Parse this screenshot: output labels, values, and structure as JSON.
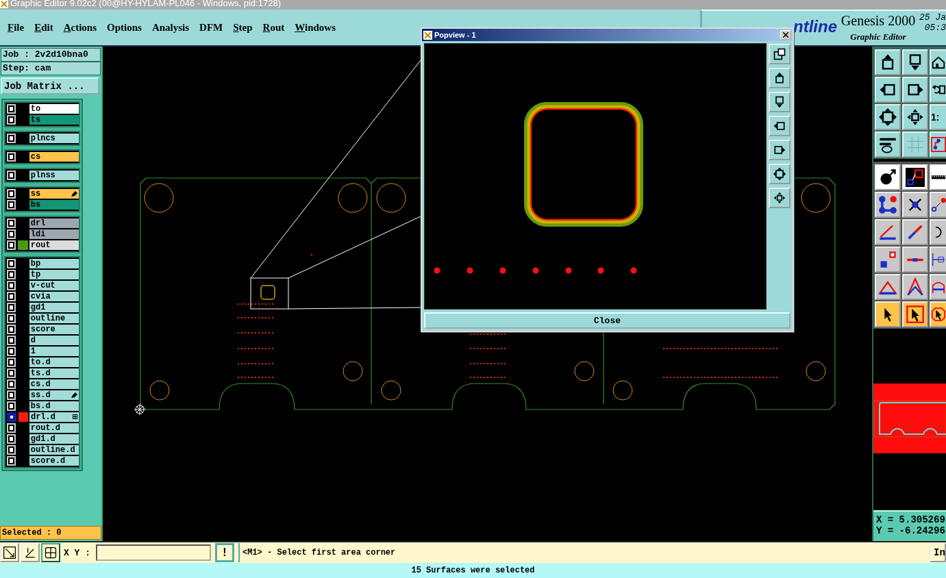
{
  "window": {
    "title": "Graphic Editor 9.02c2 (00@HY-HYLAM-PL046 - Windows, pid:1728)"
  },
  "menu": [
    {
      "label": "File",
      "mnemonic": true
    },
    {
      "label": "Edit",
      "mnemonic": true
    },
    {
      "label": "Actions",
      "mnemonic": true
    },
    {
      "label": "Options",
      "mnemonic": false
    },
    {
      "label": "Analysis",
      "mnemonic": false
    },
    {
      "label": "DFM",
      "mnemonic": false
    },
    {
      "label": "Step",
      "mnemonic": true
    },
    {
      "label": "Rout",
      "mnemonic": true
    },
    {
      "label": "Windows",
      "mnemonic": true
    }
  ],
  "branding": {
    "logo": "ntline",
    "product": "Genesis 2000",
    "subtitle": "Graphic Editor",
    "date": "25 Ja",
    "time": "05:3"
  },
  "job": {
    "job": "Job : 2v2d10bna0",
    "step": "Step: cam",
    "matrix_button": "Job Matrix ..."
  },
  "layer_groups": [
    {
      "layers": [
        {
          "name": "to",
          "color": "#ffffff",
          "selected": false,
          "edited": false,
          "tagged": false
        },
        {
          "name": "ts",
          "color": "#139676",
          "selected": false,
          "edited": false,
          "tagged": false
        }
      ]
    },
    {
      "layers": [
        {
          "name": "plncs",
          "color": "#a2dcd8",
          "selected": false,
          "edited": false,
          "tagged": false
        }
      ]
    },
    {
      "layers": [
        {
          "name": "cs",
          "color": "#ffc24a",
          "selected": false,
          "edited": false,
          "tagged": false
        }
      ]
    },
    {
      "layers": [
        {
          "name": "plnss",
          "color": "#a2dcd8",
          "selected": false,
          "edited": false,
          "tagged": false
        }
      ]
    },
    {
      "layers": [
        {
          "name": "ss",
          "color": "#ffc24a",
          "selected": false,
          "edited": true,
          "tagged": false
        },
        {
          "name": "bs",
          "color": "#139676",
          "selected": false,
          "edited": false,
          "tagged": false
        }
      ]
    },
    {
      "layers": [
        {
          "name": "drl",
          "color": "#9ca8b0",
          "selected": false,
          "edited": false,
          "tagged": false
        },
        {
          "name": "ldi",
          "color": "#9ca8b0",
          "selected": false,
          "edited": false,
          "tagged": false
        },
        {
          "name": "rout",
          "color": "#dcdcdc",
          "swatch": {
            "color": "#4a9a10"
          },
          "selected": false,
          "edited": false,
          "tagged": false
        }
      ]
    },
    {
      "layers": [
        {
          "name": "bp",
          "color": "#a2dcd8",
          "selected": false,
          "edited": false,
          "tagged": false
        },
        {
          "name": "tp",
          "color": "#a2dcd8",
          "selected": false,
          "edited": false,
          "tagged": false
        },
        {
          "name": "v-cut",
          "color": "#a2dcd8",
          "selected": false,
          "edited": false,
          "tagged": false
        },
        {
          "name": "cvia",
          "color": "#a2dcd8",
          "selected": false,
          "edited": false,
          "tagged": false
        },
        {
          "name": "gd1",
          "color": "#a2dcd8",
          "selected": false,
          "edited": false,
          "tagged": false
        },
        {
          "name": "outline",
          "color": "#a2dcd8",
          "selected": false,
          "edited": false,
          "tagged": false
        },
        {
          "name": "score",
          "color": "#a2dcd8",
          "selected": false,
          "edited": false,
          "tagged": false
        },
        {
          "name": "d",
          "color": "#a2dcd8",
          "selected": false,
          "edited": false,
          "tagged": false
        },
        {
          "name": "1",
          "color": "#a2dcd8",
          "selected": false,
          "edited": false,
          "tagged": false
        },
        {
          "name": "to.d",
          "color": "#a2dcd8",
          "selected": false,
          "edited": false,
          "tagged": false
        },
        {
          "name": "ts.d",
          "color": "#a2dcd8",
          "selected": false,
          "edited": false,
          "tagged": false
        },
        {
          "name": "cs.d",
          "color": "#a2dcd8",
          "selected": false,
          "edited": false,
          "tagged": false
        },
        {
          "name": "ss.d",
          "color": "#a2dcd8",
          "selected": false,
          "edited": true,
          "tagged": false
        },
        {
          "name": "bs.d",
          "color": "#a2dcd8",
          "selected": false,
          "edited": false,
          "tagged": false
        },
        {
          "name": "drl.d",
          "color": "#a2dcd8",
          "swatch": {
            "color": "#ff1a10"
          },
          "selected": true,
          "edited": false,
          "tagged": true
        },
        {
          "name": "rout.d",
          "color": "#a2dcd8",
          "selected": false,
          "edited": false,
          "tagged": false
        },
        {
          "name": "gd1.d",
          "color": "#a2dcd8",
          "selected": false,
          "edited": false,
          "tagged": false
        },
        {
          "name": "outline.d",
          "color": "#a2dcd8",
          "selected": false,
          "edited": false,
          "tagged": false
        },
        {
          "name": "score.d",
          "color": "#a2dcd8",
          "selected": false,
          "edited": false,
          "tagged": false
        }
      ]
    }
  ],
  "selected_count": "Selected : 0",
  "toolbar_scale_label": "1:",
  "popview": {
    "title": "Popview - 1",
    "close": "Close"
  },
  "coordinates": {
    "x": "X = 5.305269",
    "y": "Y = -6.24296"
  },
  "command_bar": {
    "xy_label": "X Y :",
    "alert_button": "!",
    "message": "<M1> - Select first area corner",
    "right_button": "In"
  },
  "status": "15 Surfaces were selected"
}
